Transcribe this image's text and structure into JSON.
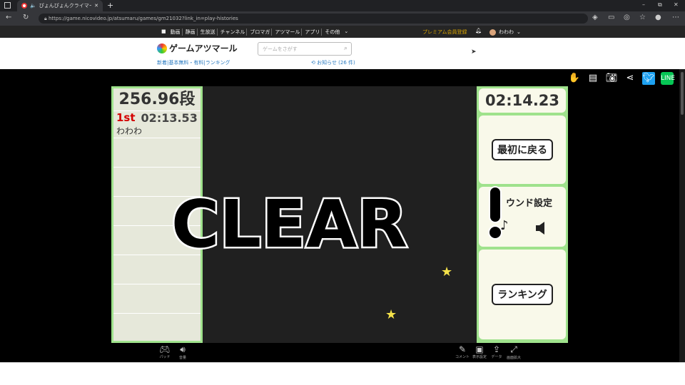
{
  "browser": {
    "tab_title": "ぴょんぴょんクライマー - ゲームア",
    "url": "https://game.nicovideo.jp/atsumaru/games/gm21032?link_in=play-histories",
    "win_min": "–",
    "win_max": "⧉",
    "win_close": "✕",
    "new_tab": "+",
    "tab_close": "✕"
  },
  "nico_nav": {
    "links": [
      "動画",
      "静画",
      "生放送",
      "チャンネル",
      "ブロマガ",
      "アツマール",
      "アプリ",
      "その他"
    ],
    "premium": "プレミアム会員登録",
    "user": "わわわ"
  },
  "header": {
    "logo": "ゲームアツマール",
    "search_placeholder": "ゲームをさがす",
    "subnav": "新着|基本無料・有料|ランキング",
    "notice": "お知らせ (26 件)"
  },
  "game": {
    "score": "256.96段",
    "rank": "1st",
    "rank_time": "02:13.53",
    "player": "わわわ",
    "timer": "02:14.23",
    "restart_label": "最初に戻る",
    "sound_label": "ウンド設定",
    "ranking_label": "ランキング",
    "clear": "CLEAR"
  },
  "bottom": {
    "pad": "パッド",
    "sound": "音量",
    "comment": "コメント",
    "display": "表示設定",
    "data": "データ",
    "fullscreen": "画面拡大"
  }
}
